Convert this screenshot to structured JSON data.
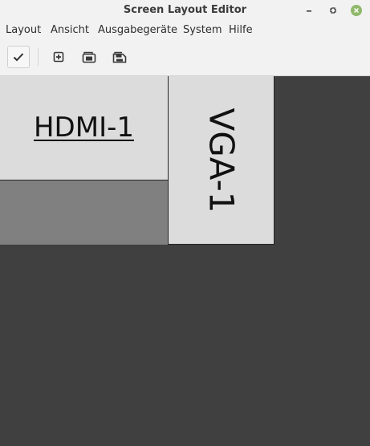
{
  "window": {
    "title": "Screen Layout Editor"
  },
  "menubar": {
    "items": [
      {
        "label": "Layout"
      },
      {
        "label": "Ansicht"
      },
      {
        "label": "Ausgabegeräte"
      },
      {
        "label": "System"
      },
      {
        "label": "Hilfe"
      }
    ]
  },
  "toolbar": {
    "buttons": [
      {
        "icon": "check-icon"
      },
      {
        "icon": "new-layout-icon"
      },
      {
        "icon": "open-layout-icon"
      },
      {
        "icon": "save-layout-icon"
      }
    ]
  },
  "outputs": [
    {
      "name": "HDMI-1",
      "orientation": "normal",
      "selected": true
    },
    {
      "name": "VGA-1",
      "orientation": "rotated-right",
      "selected": false
    }
  ],
  "colors": {
    "canvas_bg": "#404040",
    "output_fill": "#dcdcdc",
    "screen_area": "#808080",
    "close_button": "#8fb86b"
  }
}
